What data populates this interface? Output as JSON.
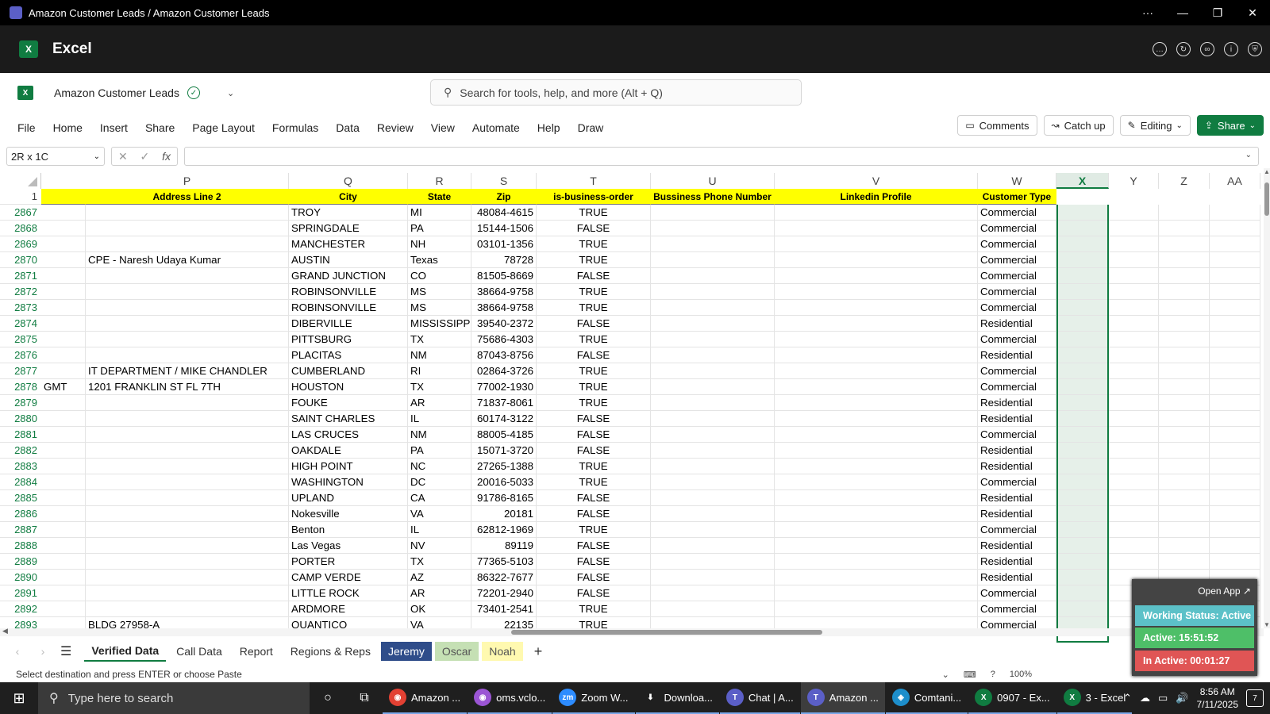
{
  "window": {
    "title": "Amazon Customer Leads / Amazon Customer Leads",
    "controls": [
      "···",
      "—",
      "❐",
      "✕"
    ]
  },
  "app": {
    "name": "Excel",
    "logo_letter": "X"
  },
  "doc": {
    "name": "Amazon Customer Leads"
  },
  "search": {
    "placeholder": "Search for tools, help, and more (Alt + Q)"
  },
  "ribbon": {
    "tabs": [
      "File",
      "Home",
      "Insert",
      "Share",
      "Page Layout",
      "Formulas",
      "Data",
      "Review",
      "View",
      "Automate",
      "Help",
      "Draw"
    ],
    "comments": "Comments",
    "catchup": "Catch up",
    "editing": "Editing",
    "share": "Share"
  },
  "formula_bar": {
    "name_box": "2R x 1C",
    "fx": "fx",
    "value": ""
  },
  "grid": {
    "columns": [
      {
        "id": "P",
        "header": "Address Line 2"
      },
      {
        "id": "Q",
        "header": "City"
      },
      {
        "id": "R",
        "header": "State"
      },
      {
        "id": "S",
        "header": "Zip"
      },
      {
        "id": "T",
        "header": "is-business-order"
      },
      {
        "id": "U",
        "header": "Bussiness Phone Number"
      },
      {
        "id": "V",
        "header": "Linkedin Profile"
      },
      {
        "id": "W",
        "header": "Customer Type"
      },
      {
        "id": "X",
        "header": ""
      },
      {
        "id": "Y",
        "header": ""
      },
      {
        "id": "Z",
        "header": ""
      },
      {
        "id": "AA",
        "header": ""
      }
    ],
    "header_row_number": "1",
    "rows": [
      {
        "n": "2867",
        "o": "",
        "p": "",
        "q": "TROY",
        "r": "MI",
        "s": "48084-4615",
        "t": "TRUE",
        "w": "Commercial"
      },
      {
        "n": "2868",
        "o": "",
        "p": "",
        "q": "SPRINGDALE",
        "r": "PA",
        "s": "15144-1506",
        "t": "FALSE",
        "w": "Commercial"
      },
      {
        "n": "2869",
        "o": "",
        "p": "",
        "q": "MANCHESTER",
        "r": "NH",
        "s": "03101-1356",
        "t": "TRUE",
        "w": "Commercial"
      },
      {
        "n": "2870",
        "o": "",
        "p": "CPE - Naresh Udaya Kumar",
        "q": "AUSTIN",
        "r": "Texas",
        "s": "78728",
        "t": "TRUE",
        "w": "Commercial"
      },
      {
        "n": "2871",
        "o": "",
        "p": "",
        "q": "GRAND JUNCTION",
        "r": "CO",
        "s": "81505-8669",
        "t": "FALSE",
        "w": "Commercial"
      },
      {
        "n": "2872",
        "o": "",
        "p": "",
        "q": "ROBINSONVILLE",
        "r": "MS",
        "s": "38664-9758",
        "t": "TRUE",
        "w": "Commercial"
      },
      {
        "n": "2873",
        "o": "",
        "p": "",
        "q": "ROBINSONVILLE",
        "r": "MS",
        "s": "38664-9758",
        "t": "TRUE",
        "w": "Commercial"
      },
      {
        "n": "2874",
        "o": "",
        "p": "",
        "q": "DIBERVILLE",
        "r": "MISSISSIPPI",
        "s": "39540-2372",
        "t": "FALSE",
        "w": "Residential"
      },
      {
        "n": "2875",
        "o": "",
        "p": "",
        "q": "PITTSBURG",
        "r": "TX",
        "s": "75686-4303",
        "t": "TRUE",
        "w": "Commercial"
      },
      {
        "n": "2876",
        "o": "",
        "p": "",
        "q": "PLACITAS",
        "r": "NM",
        "s": "87043-8756",
        "t": "FALSE",
        "w": "Residential"
      },
      {
        "n": "2877",
        "o": "",
        "p": "IT DEPARTMENT / MIKE CHANDLER",
        "q": "CUMBERLAND",
        "r": "RI",
        "s": "02864-3726",
        "t": "TRUE",
        "w": "Commercial"
      },
      {
        "n": "2878",
        "o": "GMT",
        "p": "1201 FRANKLIN ST FL 7TH",
        "q": "HOUSTON",
        "r": "TX",
        "s": "77002-1930",
        "t": "TRUE",
        "w": "Commercial"
      },
      {
        "n": "2879",
        "o": "",
        "p": "",
        "q": "FOUKE",
        "r": "AR",
        "s": "71837-8061",
        "t": "TRUE",
        "w": "Residential"
      },
      {
        "n": "2880",
        "o": "",
        "p": "",
        "q": "SAINT CHARLES",
        "r": "IL",
        "s": "60174-3122",
        "t": "FALSE",
        "w": "Residential"
      },
      {
        "n": "2881",
        "o": "",
        "p": "",
        "q": "LAS CRUCES",
        "r": "NM",
        "s": "88005-4185",
        "t": "FALSE",
        "w": "Commercial"
      },
      {
        "n": "2882",
        "o": "",
        "p": "",
        "q": "OAKDALE",
        "r": "PA",
        "s": "15071-3720",
        "t": "FALSE",
        "w": "Residential"
      },
      {
        "n": "2883",
        "o": "",
        "p": "",
        "q": "HIGH POINT",
        "r": "NC",
        "s": "27265-1388",
        "t": "TRUE",
        "w": "Residential"
      },
      {
        "n": "2884",
        "o": "",
        "p": "",
        "q": "WASHINGTON",
        "r": "DC",
        "s": "20016-5033",
        "t": "TRUE",
        "w": "Commercial"
      },
      {
        "n": "2885",
        "o": "",
        "p": "",
        "q": "UPLAND",
        "r": "CA",
        "s": "91786-8165",
        "t": "FALSE",
        "w": "Residential"
      },
      {
        "n": "2886",
        "o": "",
        "p": "",
        "q": "Nokesville",
        "r": "VA",
        "s": "20181",
        "t": "FALSE",
        "w": "Residential"
      },
      {
        "n": "2887",
        "o": "",
        "p": "",
        "q": "Benton",
        "r": "IL",
        "s": "62812-1969",
        "t": "TRUE",
        "w": "Commercial"
      },
      {
        "n": "2888",
        "o": "",
        "p": "",
        "q": "Las Vegas",
        "r": "NV",
        "s": "89119",
        "t": "FALSE",
        "w": "Residential"
      },
      {
        "n": "2889",
        "o": "",
        "p": "",
        "q": "PORTER",
        "r": "TX",
        "s": "77365-5103",
        "t": "FALSE",
        "w": "Residential"
      },
      {
        "n": "2890",
        "o": "",
        "p": "",
        "q": "CAMP VERDE",
        "r": "AZ",
        "s": "86322-7677",
        "t": "FALSE",
        "w": "Residential"
      },
      {
        "n": "2891",
        "o": "",
        "p": "",
        "q": "LITTLE ROCK",
        "r": "AR",
        "s": "72201-2940",
        "t": "FALSE",
        "w": "Commercial"
      },
      {
        "n": "2892",
        "o": "",
        "p": "",
        "q": "ARDMORE",
        "r": "OK",
        "s": "73401-2541",
        "t": "TRUE",
        "w": "Commercial"
      },
      {
        "n": "2893",
        "o": "",
        "p": "BLDG 27958-A",
        "q": "QUANTICO",
        "r": "VA",
        "s": "22135",
        "t": "TRUE",
        "w": "Commercial"
      }
    ]
  },
  "sheets": {
    "tabs": [
      {
        "label": "Verified Data",
        "style": "active"
      },
      {
        "label": "Call Data",
        "style": ""
      },
      {
        "label": "Report",
        "style": ""
      },
      {
        "label": "Regions & Reps",
        "style": ""
      },
      {
        "label": "Jeremy",
        "style": "blue"
      },
      {
        "label": "Oscar",
        "style": "green"
      },
      {
        "label": "Noah",
        "style": "yellow"
      }
    ],
    "add": "+"
  },
  "status": {
    "message": "Select destination and press ENTER or choose Paste",
    "zoom": "100%"
  },
  "widget": {
    "open_app": "Open App ↗",
    "working_status": "Working Status: Active",
    "active": "Active: 15:51:52",
    "inactive": "In Active: 00:01:27"
  },
  "taskbar": {
    "search_placeholder": "Type here to search",
    "apps": [
      {
        "label": "Amazon ...",
        "icon": "chrome-icon",
        "color": "#e34133",
        "glyph": "◉",
        "active": false
      },
      {
        "label": "oms.vclo...",
        "icon": "chrome-icon",
        "color": "#9b55d4",
        "glyph": "◉",
        "active": false
      },
      {
        "label": "Zoom W...",
        "icon": "zoom-icon",
        "color": "#2d8cff",
        "glyph": "zm",
        "active": false
      },
      {
        "label": "Downloa...",
        "icon": "download-icon",
        "color": "transparent",
        "glyph": "⬇",
        "active": false
      },
      {
        "label": "Chat | A...",
        "icon": "teams-icon",
        "color": "#5b5fc7",
        "glyph": "T",
        "active": false
      },
      {
        "label": "Amazon ...",
        "icon": "teams-icon",
        "color": "#5b5fc7",
        "glyph": "T",
        "active": true
      },
      {
        "label": "Comtani...",
        "icon": "edge-icon",
        "color": "#1d8ecb",
        "glyph": "◈",
        "active": false
      },
      {
        "label": "0907 - Ex...",
        "icon": "excel-icon",
        "color": "#107c41",
        "glyph": "X",
        "active": false
      },
      {
        "label": "3 - Excel",
        "icon": "excel-icon",
        "color": "#107c41",
        "glyph": "X",
        "active": false
      }
    ],
    "time": "8:56 AM",
    "date": "7/11/2025",
    "notifications": "7"
  },
  "colors": {
    "accent": "#107c41",
    "header_fill": "#ffff00",
    "selection_fill": "#e6f0e9"
  }
}
